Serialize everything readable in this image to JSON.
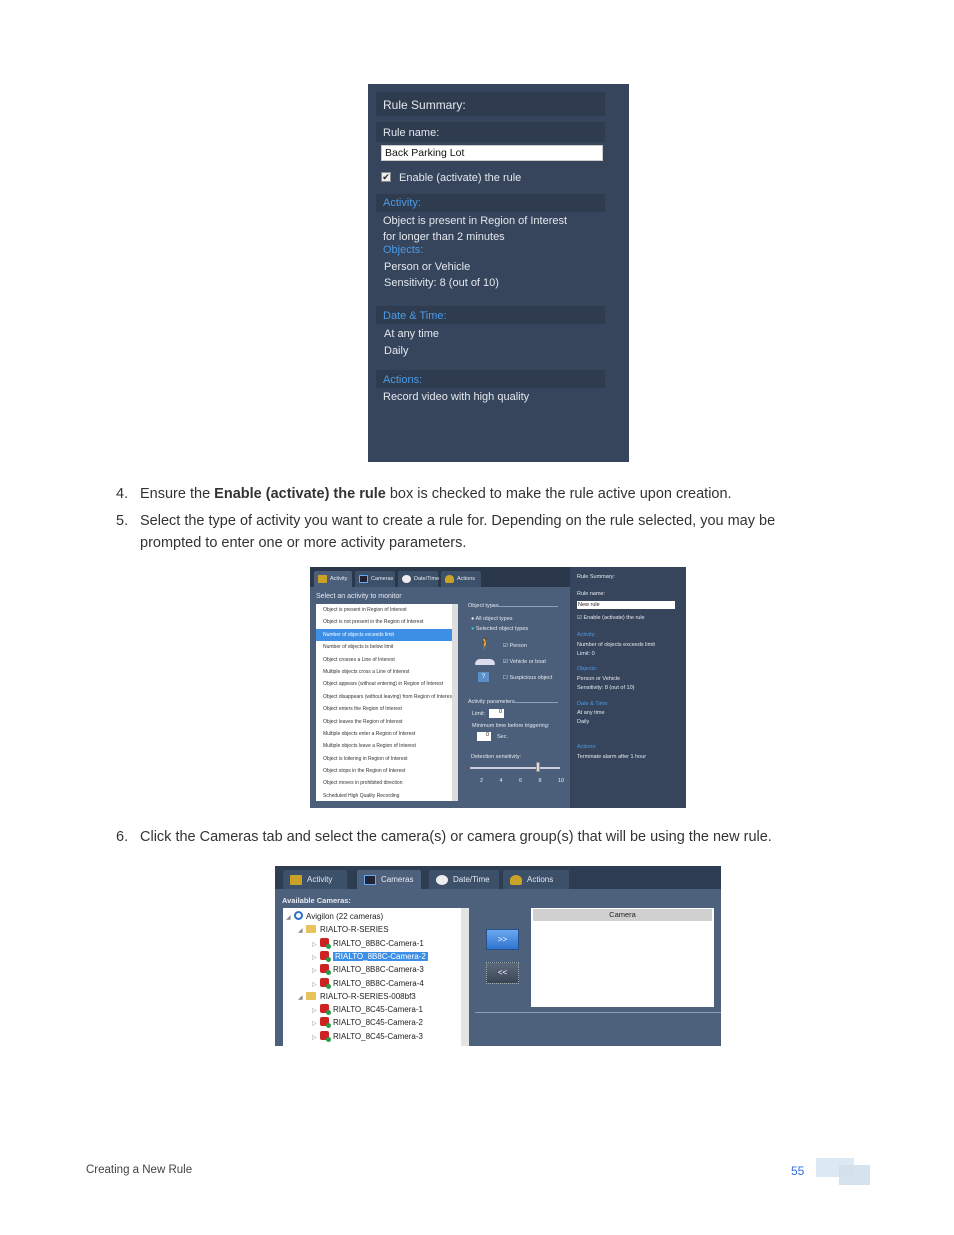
{
  "rule_summary_panel": {
    "title": "Rule Summary:",
    "rule_name_label": "Rule name:",
    "rule_name_value": "Back Parking Lot",
    "enable_label": "Enable (activate) the rule",
    "enable_checked": true,
    "activity_heading": "Activity:",
    "activity_lines": [
      "Object is present in Region of Interest",
      "for longer than 2 minutes"
    ],
    "objects_heading": "Objects:",
    "objects_lines": [
      "Person or Vehicle",
      "Sensitivity: 8 (out of 10)"
    ],
    "datetime_heading": "Date & Time:",
    "datetime_lines": [
      "At any time",
      "Daily"
    ],
    "actions_heading": "Actions:",
    "actions_lines": [
      "Record video with high quality"
    ]
  },
  "steps": [
    {
      "num": "4.",
      "pre": "Ensure the ",
      "bold": "Enable (activate) the rule",
      "post": " box is checked to make the rule active upon creation."
    },
    {
      "num": "5.",
      "lines": [
        "Select the type of activity you want to create a rule for. Depending on the rule selected, you may be",
        "prompted to enter one or more activity parameters."
      ]
    },
    {
      "num": "6.",
      "lines": [
        "Click the Cameras tab and select the camera(s) or camera group(s) that will be using the new rule."
      ]
    }
  ],
  "activity_screen": {
    "tabs": [
      "Activity",
      "Cameras",
      "Date/Time",
      "Actions"
    ],
    "list_title": "Select an activity to monitor",
    "activities": [
      "Object is present in Region of Interest",
      "Object is not present in the Region of Interest",
      "Number of objects exceeds limit",
      "Number of objects is below limit",
      "Object crosses a Line of Interest",
      "Multiple objects cross a Line of Interest",
      "Object appears (without entering) in Region of Interest",
      "Object disappears (without leaving) from Region of Interest",
      "Object enters the Region of Interest",
      "Object leaves the Region of Interest",
      "Multiple objects enter a Region of Interest",
      "Multiple objects leave a Region of Interest",
      "Object is loitering in Region of Interest",
      "Object stops in the Region of Interest",
      "Object moves in prohibited direction",
      "Scheduled High Quality Recording"
    ],
    "selected_activity": "Number of objects exceeds limit",
    "object_types_label": "Object types",
    "radio_all": "All object types",
    "radio_selected": "Selected object types",
    "object_options": [
      {
        "label": "Person",
        "checked": true
      },
      {
        "label": "Vehicle or boat",
        "checked": true
      },
      {
        "label": "Suspicious object",
        "checked": false
      }
    ],
    "activity_params_label": "Activity parameters",
    "limit_label": "Limit:",
    "limit_value": "0",
    "min_time_label": "Minimum time before triggering:",
    "min_time_value": "0",
    "min_time_unit": "Sec.",
    "sensitivity_label": "Detection sensitivity:",
    "sensitivity_value": 8,
    "sensitivity_ticks": [
      "2",
      "4",
      "6",
      "8",
      "10"
    ],
    "summary": {
      "title": "Rule Summary:",
      "rule_name_label": "Rule name:",
      "rule_name_value": "New rule",
      "enable_label": "Enable (activate) the rule",
      "activity_heading": "Activity:",
      "activity_lines": [
        "Number of objects exceeds limit",
        "Limit: 0"
      ],
      "objects_heading": "Objects:",
      "objects_lines": [
        "Person or Vehicle",
        "Sensitivity: 8 (out of 10)"
      ],
      "datetime_heading": "Date & Time:",
      "datetime_lines": [
        "At any time",
        "Daily"
      ],
      "actions_heading": "Actions:",
      "actions_lines": [
        "Terminate alarm after 1 hour"
      ]
    }
  },
  "cameras_screen": {
    "tabs": [
      "Activity",
      "Cameras",
      "Date/Time",
      "Actions"
    ],
    "available_label": "Available Cameras:",
    "root": "Avigilon  (22 cameras)",
    "groups": [
      {
        "name": "RIALTO-R-SERIES",
        "cameras": [
          "RIALTO_8B8C-Camera-1",
          "RIALTO_8B8C-Camera-2",
          "RIALTO_8B8C-Camera-3",
          "RIALTO_8B8C-Camera-4"
        ]
      },
      {
        "name": "RIALTO-R-SERIES-008bf3",
        "cameras": [
          "RIALTO_8C45-Camera-1",
          "RIALTO_8C45-Camera-2",
          "RIALTO_8C45-Camera-3"
        ]
      }
    ],
    "selected_camera": "RIALTO_8B8C-Camera-2",
    "add_button": ">>",
    "remove_button": "<<",
    "camera_column": "Camera"
  },
  "footer": {
    "section": "Creating a New Rule",
    "page": "55"
  },
  "colors": {
    "accent": "#4b9be6",
    "panel": "#36455b",
    "selection": "#3d8fe6",
    "page_number": "#2f6fe0"
  }
}
